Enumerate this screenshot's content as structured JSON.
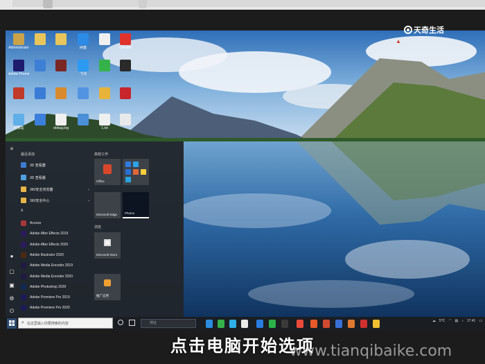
{
  "watermark": {
    "logo_text": "天奇生活",
    "url": "www.tianqibaike.com"
  },
  "caption": "点击电脑开始选项",
  "desktop_icons": [
    {
      "label": "Administrator",
      "color": "#c9a24a"
    },
    {
      "label": "",
      "color": "#e9c65b"
    },
    {
      "label": "",
      "color": "#e9c65b"
    },
    {
      "label": "网盘",
      "color": "#2b8be6"
    },
    {
      "label": "",
      "color": "#f0f0f0"
    },
    {
      "label": "Chrome",
      "color": "#e0322d"
    },
    {
      "label": "Adobe Premiere",
      "color": "#1f1b6e"
    },
    {
      "label": "",
      "color": "#3e7fd6"
    },
    {
      "label": "",
      "color": "#7a2624"
    },
    {
      "label": "飞书",
      "color": "#2d9af2"
    },
    {
      "label": "",
      "color": "#35b34a"
    },
    {
      "label": "",
      "color": "#2a2a2a"
    },
    {
      "label": "",
      "color": "#c03a2a"
    },
    {
      "label": "",
      "color": "#3a7bd5"
    },
    {
      "label": "",
      "color": "#d98a2f"
    },
    {
      "label": "",
      "color": "#5294e2"
    },
    {
      "label": "",
      "color": "#e8b33a"
    },
    {
      "label": "",
      "color": "#c7252c"
    },
    {
      "label": "回收站",
      "color": "#5fb0e8"
    },
    {
      "label": "",
      "color": "#3b7edc"
    },
    {
      "label": "debug.log",
      "color": "#f0f0f0"
    },
    {
      "label": "",
      "color": "#4a8fd8"
    },
    {
      "label": "1.txt",
      "color": "#f0f0f0"
    },
    {
      "label": "",
      "color": "#e9e9e9"
    }
  ],
  "start_menu": {
    "recent_header": "最近添加",
    "recent_item": "3D 查看器",
    "tiles_header": "高效工作",
    "browse_header": "浏览",
    "folders": [
      "360安全浏览器",
      "360安全中心"
    ],
    "letter": "A",
    "apps": [
      "Access",
      "Adobe After Effects 2019",
      "Adobe After Effects 2020",
      "Adobe Illustrator 2020",
      "Adobe Media Encoder 2019",
      "Adobe Media Encoder 2020",
      "Adobe Photoshop 2020",
      "Adobe Premiere Pro 2019",
      "Adobe Premiere Pro 2020"
    ],
    "tiles": {
      "office": "Office",
      "edge": "Microsoft Edge",
      "photos": "Photos",
      "store": "Microsoft Store",
      "promo": "推广应用"
    }
  },
  "taskbar": {
    "search_placeholder": "在这里输入你要搜索的内容",
    "address_placeholder": "地址",
    "weather": "5°C",
    "time": "17:41"
  }
}
